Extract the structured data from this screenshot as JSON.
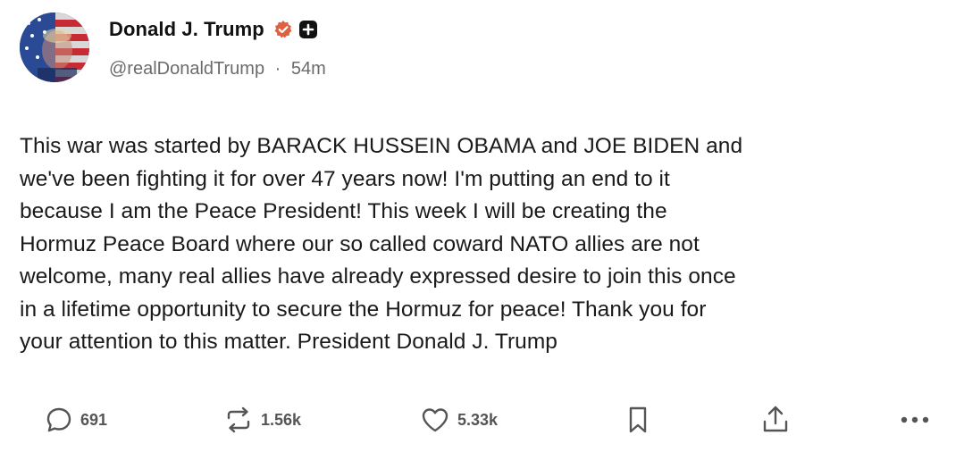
{
  "post": {
    "author_name": "Donald J. Trump",
    "handle": "@realDonaldTrump",
    "separator": "·",
    "time_ago": "54m",
    "body": "This war was started by BARACK HUSSEIN OBAMA and JOE BIDEN and\nwe've been fighting it for over 47 years now! I'm putting an end to it\nbecause I am the Peace President! This week I will be creating the\nHormuz Peace Board where our so called coward NATO allies are not\nwelcome, many real allies have already expressed desire to join this once\nin a lifetime opportunity to secure the Hormuz for peace! Thank you for\nyour attention to this matter. President Donald J. Trump"
  },
  "actions": {
    "replies": "691",
    "reposts": "1.56k",
    "likes": "5.33k"
  },
  "icons": {
    "verified": "verified-badge-icon",
    "plus": "plus-badge-icon",
    "reply": "reply-bubble-icon",
    "repost": "repost-arrows-icon",
    "like": "heart-icon",
    "bookmark": "bookmark-icon",
    "share": "share-upload-icon",
    "more": "more-dots-icon"
  },
  "colors": {
    "verified_badge": "#e0613f",
    "plus_badge": "#111111",
    "handle_text": "#6b6b6b",
    "action_icon": "#555555"
  }
}
